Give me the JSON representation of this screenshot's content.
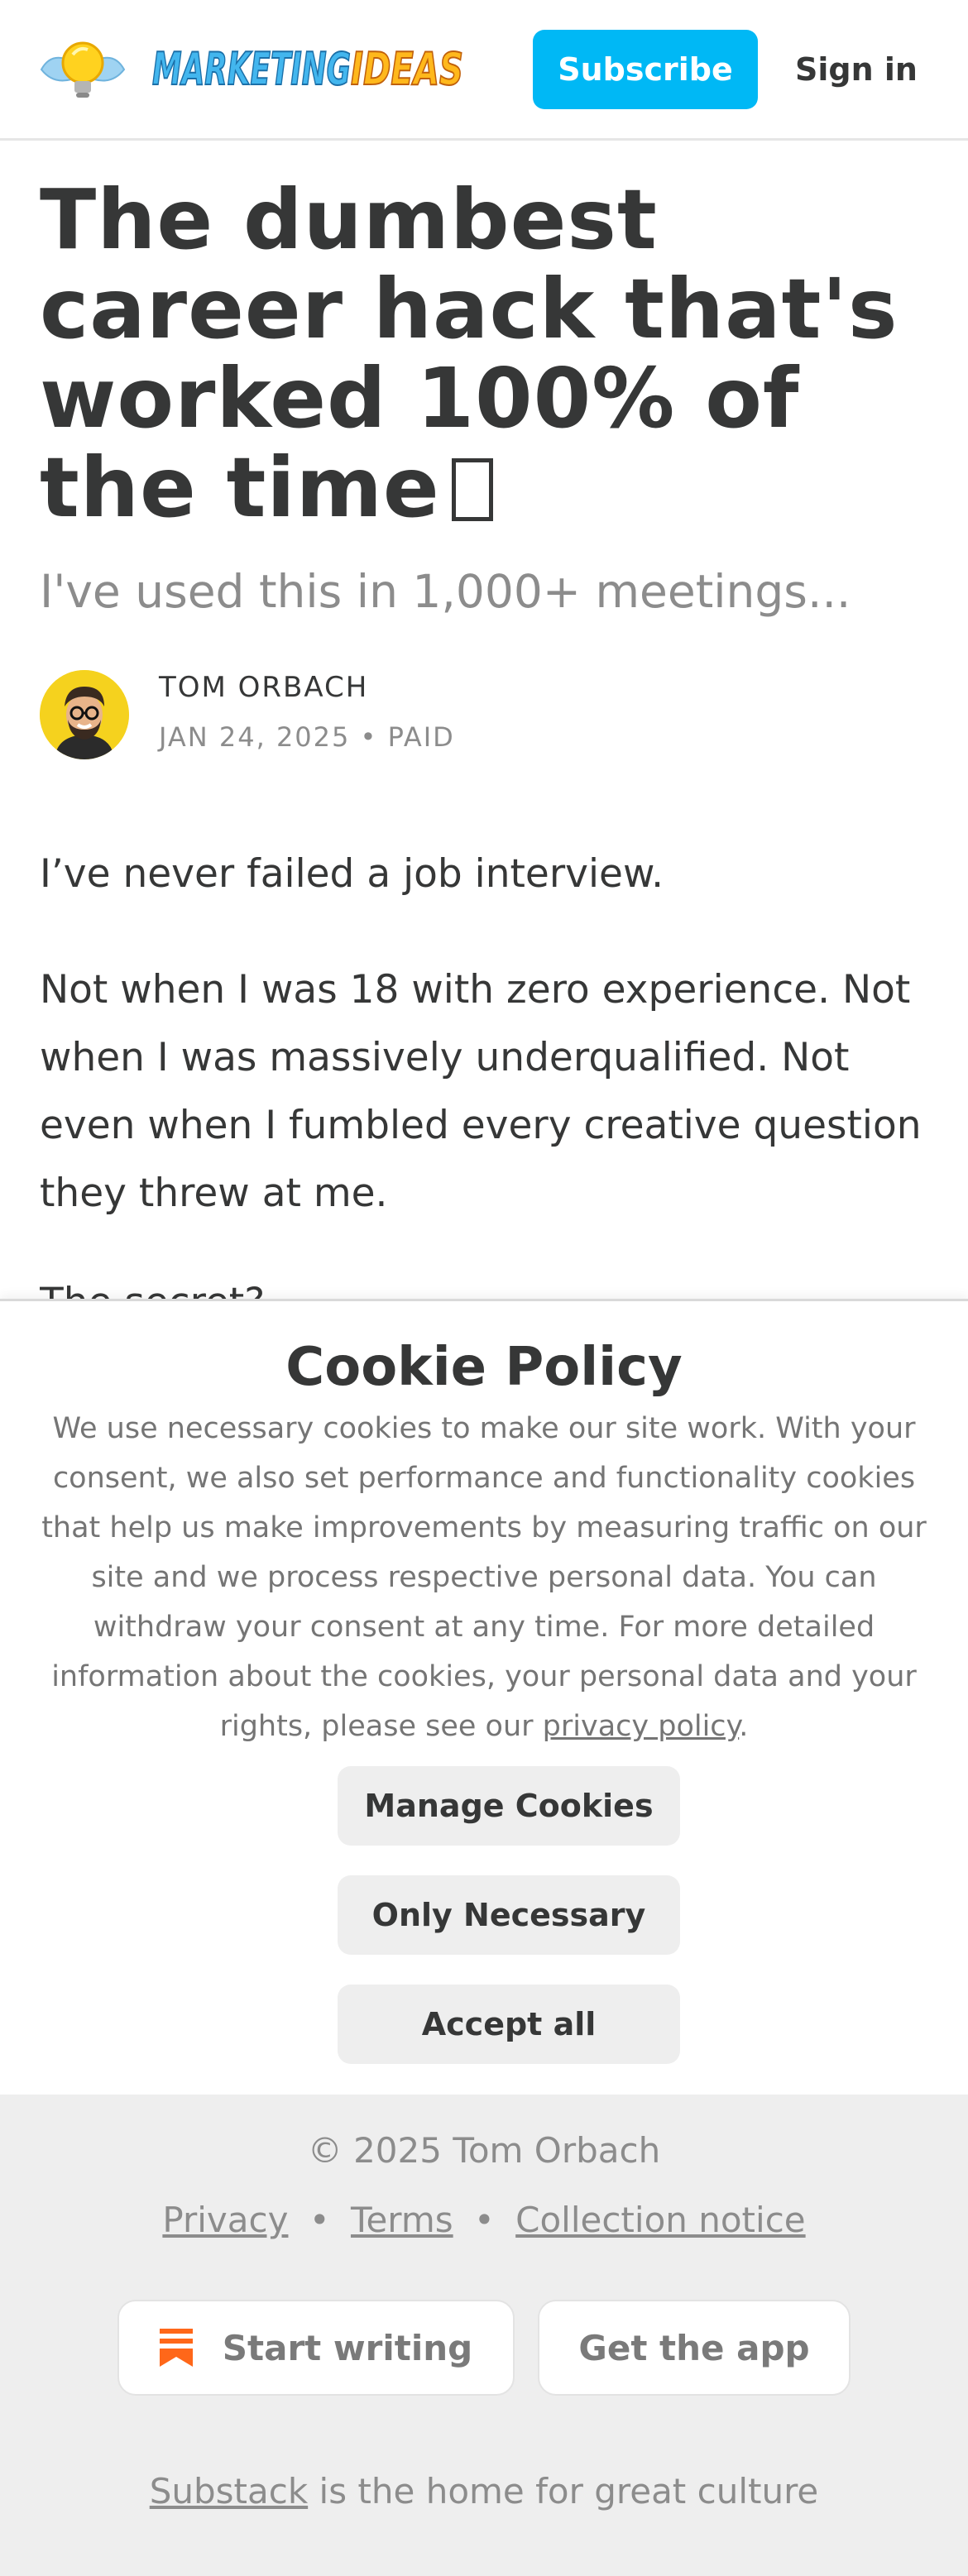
{
  "header": {
    "logo_text": "MARKETINGIDEAS",
    "subscribe_label": "Subscribe",
    "signin_label": "Sign in"
  },
  "article": {
    "title": "The dumbest career hack that's worked 100% of the time",
    "title_emoji": "💡",
    "subtitle": "I've used this in 1,000+ meetings...",
    "author": "TOM ORBACH",
    "date": "JAN 24, 2025",
    "meta_separator": "•",
    "access": "PAID",
    "paragraph_1": "I’ve never failed a job interview.",
    "paragraph_2": "Not when I was 18 with zero experience. Not when I was massively underqualified. Not even when I fumbled every creative question they threw at me.",
    "paragraph_3": "The secret?"
  },
  "cookie_banner": {
    "title": "Cookie Policy",
    "text": "We use necessary cookies to make our site work. With your consent, we also set performance and functionality cookies that help us make improvements by measuring traffic on our site and we process respective personal data. You can withdraw your consent at any time. For more detailed information about the cookies, your personal data and your rights, please see our ",
    "link": "privacy policy",
    "text_end": ".",
    "buttons": [
      "Manage Cookies",
      "Only Necessary",
      "Accept all"
    ]
  },
  "footer": {
    "copyright": "© 2025 Tom Orbach",
    "links": [
      "Privacy",
      "Terms",
      "Collection notice"
    ],
    "link_separator": "•",
    "start_writing": "Start writing",
    "get_app": "Get the app",
    "tagline_link": "Substack",
    "tagline_rest": " is the home for great culture"
  },
  "colors": {
    "accent": "#00b8f5",
    "text": "#363737",
    "muted": "#8c8c8c",
    "footer_bg": "#eeeeee",
    "substack_orange": "#ff6719"
  },
  "icons": [
    "lightbulb-logo-icon",
    "author-avatar",
    "substack-bookmark-icon"
  ]
}
